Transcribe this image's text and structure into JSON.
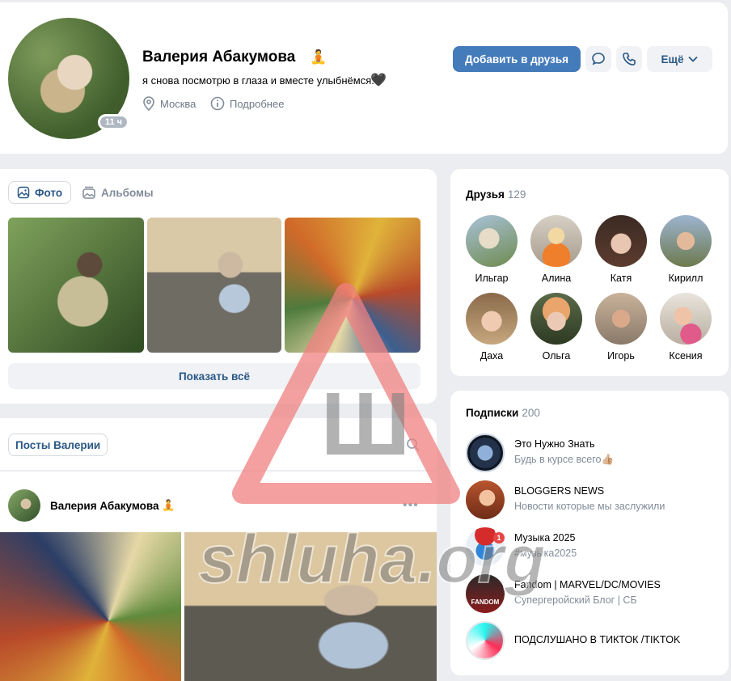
{
  "profile": {
    "name": "Валерия Абакумова",
    "name_emoji": "🧘",
    "status": "я снова посмотрю в глаза и вместе улыбнёмся.",
    "status_emoji": "🖤",
    "online_badge": "11 ч",
    "city": "Москва",
    "more_info": "Подробнее",
    "add_friend": "Добавить в друзья",
    "more_button": "Ещё"
  },
  "photos": {
    "tab_photos": "Фото",
    "tab_albums": "Альбомы",
    "show_all": "Показать всё"
  },
  "wall": {
    "tab_posts": "Посты Валерии",
    "post": {
      "author": "Валерия Абакумова",
      "author_emoji": "🧘"
    }
  },
  "friends": {
    "title": "Друзья",
    "count": "129",
    "items": [
      {
        "name": "Ильгар"
      },
      {
        "name": "Алина"
      },
      {
        "name": "Катя"
      },
      {
        "name": "Кирилл"
      },
      {
        "name": "Даха"
      },
      {
        "name": "Ольга"
      },
      {
        "name": "Игорь"
      },
      {
        "name": "Ксения"
      }
    ]
  },
  "subscriptions": {
    "title": "Подписки",
    "count": "200",
    "items": [
      {
        "title": "Это Нужно Знать",
        "subtitle": "Будь в курсе всего👍🏼"
      },
      {
        "title": "BLOGGERS NEWS",
        "subtitle": "Новости которые мы заслужили"
      },
      {
        "title": "Музыка 2025",
        "subtitle": "#музыка2025",
        "badge": "1"
      },
      {
        "title": "Fandom | MARVEL/DC/MOVIES",
        "subtitle": "Супергеройский Блог | СБ",
        "avatar_text": "FANDOM"
      },
      {
        "title": "ПОДСЛУШАНО В ТИКТОК /TIKTOK",
        "subtitle": ""
      }
    ]
  },
  "watermark": {
    "letter": "Ш",
    "text": "shluha.org"
  },
  "colors": {
    "accent": "#447bba",
    "link": "#2a5885",
    "secondary_text": "#818c99",
    "page_bg": "#ebedf0",
    "watermark_red": "#f08080"
  }
}
